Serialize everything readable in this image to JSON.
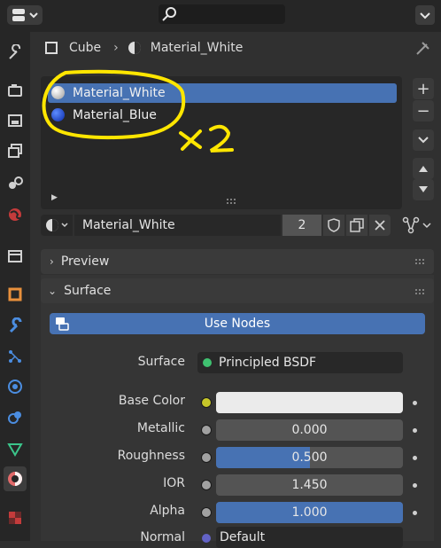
{
  "breadcrumb": {
    "object": "Cube",
    "material": "Material_White"
  },
  "slots": [
    {
      "label": "Material_White",
      "color": "#d6d6d6",
      "selected": true
    },
    {
      "label": "Material_Blue",
      "color": "#1f4fd1",
      "selected": false
    }
  ],
  "material_field": {
    "name": "Material_White",
    "users": "2"
  },
  "panels": {
    "preview": "Preview",
    "surface": "Surface"
  },
  "use_nodes_label": "Use Nodes",
  "surface_shader": {
    "label": "Surface",
    "value": "Principled BSDF"
  },
  "properties": [
    {
      "label": "Base Color",
      "value": "",
      "fill": 0,
      "socket_color": "#c7c729",
      "base_color": "#ebebeb"
    },
    {
      "label": "Metallic",
      "value": "0.000",
      "fill": 0.0,
      "socket_color": "#a1a1a1"
    },
    {
      "label": "Roughness",
      "value": "0.500",
      "fill": 0.5,
      "socket_color": "#a1a1a1"
    },
    {
      "label": "IOR",
      "value": "1.450",
      "fill": 0.0,
      "socket_color": "#a1a1a1"
    },
    {
      "label": "Alpha",
      "value": "1.000",
      "fill": 1.0,
      "socket_color": "#a1a1a1"
    }
  ],
  "normal": {
    "label": "Normal",
    "value": "Default"
  },
  "annotation": {
    "text": "x2",
    "color": "#ffe600"
  }
}
